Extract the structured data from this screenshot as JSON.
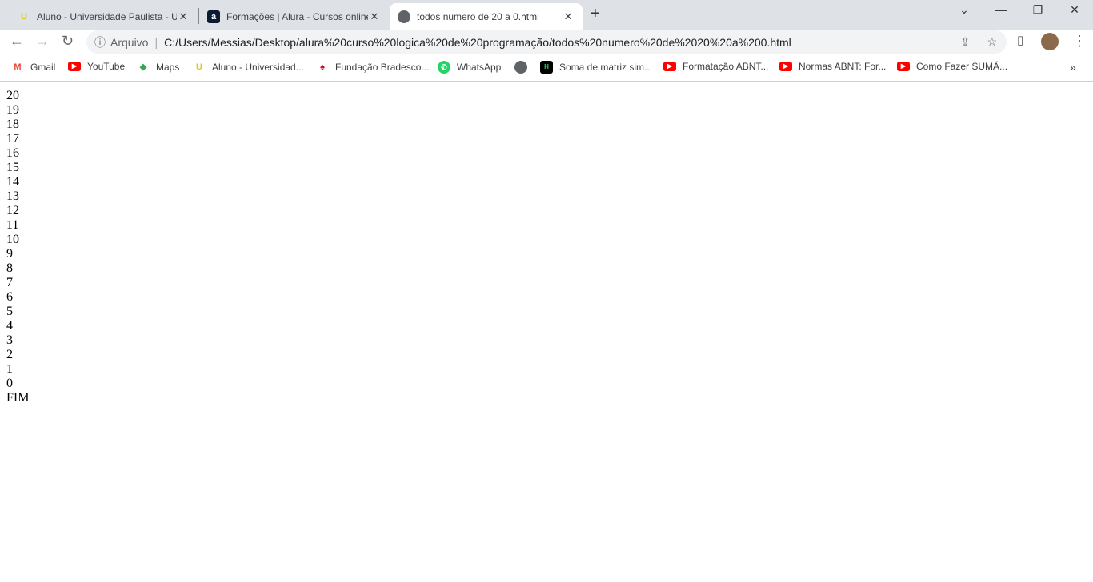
{
  "tabs": [
    {
      "title": "Aluno - Universidade Paulista - U",
      "icon": "unip-icon"
    },
    {
      "title": "Formações | Alura - Cursos online",
      "icon": "alura-icon"
    },
    {
      "title": "todos numero de 20 a 0.html",
      "icon": "globe-icon",
      "active": true
    }
  ],
  "address": {
    "security_label": "Arquivo",
    "url": "C:/Users/Messias/Desktop/alura%20curso%20logica%20de%20programação/todos%20numero%20de%2020%20a%200.html"
  },
  "bookmarks": [
    {
      "label": "Gmail",
      "icon": "gmail-icon"
    },
    {
      "label": "YouTube",
      "icon": "youtube-icon"
    },
    {
      "label": "Maps",
      "icon": "maps-icon"
    },
    {
      "label": "Aluno - Universidad...",
      "icon": "unip-icon"
    },
    {
      "label": "Fundação Bradesco...",
      "icon": "bradesco-icon"
    },
    {
      "label": "WhatsApp",
      "icon": "whatsapp-icon"
    },
    {
      "label": "",
      "icon": "globe-icon"
    },
    {
      "label": "Soma de matriz sim...",
      "icon": "hackerrank-icon"
    },
    {
      "label": "Formatação ABNT...",
      "icon": "youtube-icon"
    },
    {
      "label": "Normas ABNT: For...",
      "icon": "youtube-icon"
    },
    {
      "label": "Como Fazer SUMÁ...",
      "icon": "youtube-icon"
    }
  ],
  "lines": [
    "20",
    "19",
    "18",
    "17",
    "16",
    "15",
    "14",
    "13",
    "12",
    "11",
    "10",
    "9",
    "8",
    "7",
    "6",
    "5",
    "4",
    "3",
    "2",
    "1",
    "0",
    "FIM"
  ]
}
